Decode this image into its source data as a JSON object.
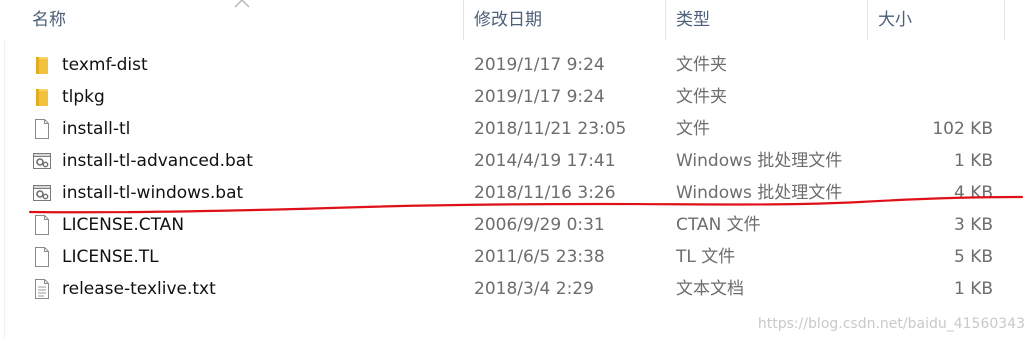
{
  "columns": {
    "name": "名称",
    "date": "修改日期",
    "type": "类型",
    "size": "大小"
  },
  "files": [
    {
      "icon": "folder-icon",
      "name": "texmf-dist",
      "date": "2019/1/17 9:24",
      "type": "文件夹",
      "size": ""
    },
    {
      "icon": "folder-icon",
      "name": "tlpkg",
      "date": "2019/1/17 9:24",
      "type": "文件夹",
      "size": ""
    },
    {
      "icon": "file-icon",
      "name": "install-tl",
      "date": "2018/11/21 23:05",
      "type": "文件",
      "size": "102 KB"
    },
    {
      "icon": "batch-file-icon",
      "name": "install-tl-advanced.bat",
      "date": "2014/4/19 17:41",
      "type": "Windows 批处理文件",
      "size": "1 KB"
    },
    {
      "icon": "batch-file-icon",
      "name": "install-tl-windows.bat",
      "date": "2018/11/16 3:26",
      "type": "Windows 批处理文件",
      "size": "4 KB"
    },
    {
      "icon": "file-icon",
      "name": "LICENSE.CTAN",
      "date": "2006/9/29 0:31",
      "type": "CTAN 文件",
      "size": "3 KB"
    },
    {
      "icon": "file-icon",
      "name": "LICENSE.TL",
      "date": "2011/6/5 23:38",
      "type": "TL 文件",
      "size": "5 KB"
    },
    {
      "icon": "text-document-icon",
      "name": "release-texlive.txt",
      "date": "2018/3/4 2:29",
      "type": "文本文档",
      "size": "1 KB"
    }
  ],
  "watermark": "https://blog.csdn.net/baidu_41560343",
  "colors": {
    "header_text": "#4c607a",
    "folder": "#f3c23c",
    "annotation_red": "#e0101a"
  }
}
